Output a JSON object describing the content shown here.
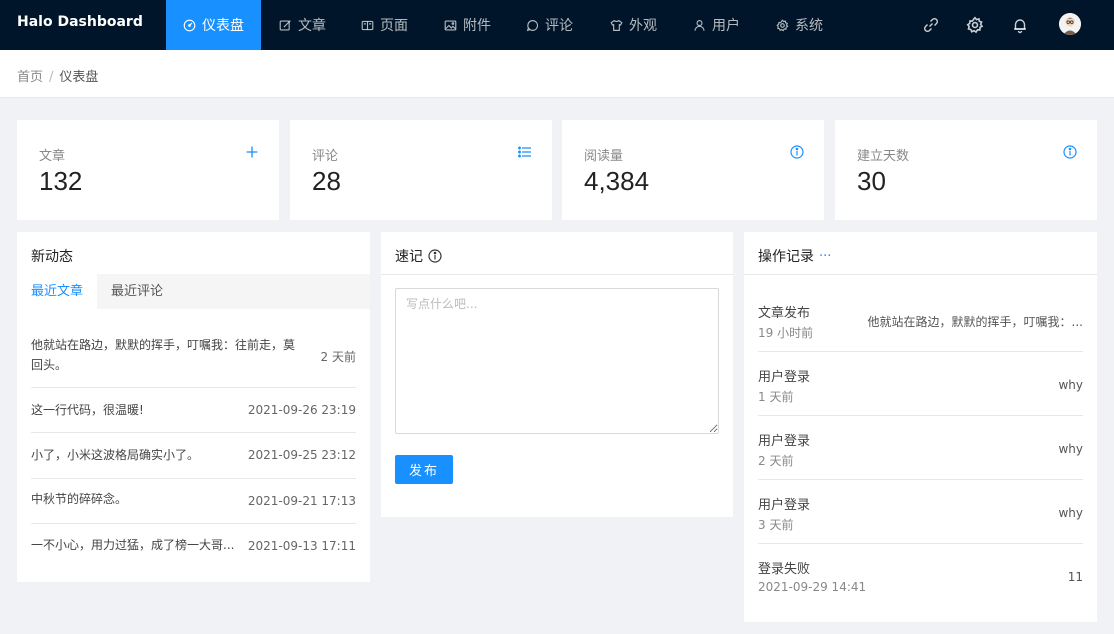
{
  "app": {
    "logo": "Halo Dashboard"
  },
  "nav": {
    "items": [
      {
        "label": "仪表盘",
        "icon": "dashboard-icon",
        "active": true
      },
      {
        "label": "文章",
        "icon": "form-icon"
      },
      {
        "label": "页面",
        "icon": "read-icon"
      },
      {
        "label": "附件",
        "icon": "picture-icon"
      },
      {
        "label": "评论",
        "icon": "message-icon"
      },
      {
        "label": "外观",
        "icon": "skin-icon"
      },
      {
        "label": "用户",
        "icon": "user-icon"
      },
      {
        "label": "系统",
        "icon": "setting-icon"
      }
    ],
    "right_icons": [
      "link-icon",
      "setting-icon",
      "bell-icon",
      "avatar"
    ]
  },
  "breadcrumb": {
    "home": "首页",
    "separator": "/",
    "current": "仪表盘"
  },
  "stats": [
    {
      "label": "文章",
      "value": "132",
      "icon": "plus-icon"
    },
    {
      "label": "评论",
      "value": "28",
      "icon": "list-icon"
    },
    {
      "label": "阅读量",
      "value": "4,384",
      "icon": "info-circle-icon"
    },
    {
      "label": "建立天数",
      "value": "30",
      "icon": "info-circle-icon"
    }
  ],
  "activity": {
    "title": "新动态",
    "tabs": [
      {
        "label": "最近文章",
        "active": true
      },
      {
        "label": "最近评论"
      }
    ],
    "items": [
      {
        "title_line1": "他就站在路边，默默的挥手，叮嘱我：往前走，莫",
        "title_line2": "回头。",
        "date": "2 天前"
      },
      {
        "title": "这一行代码，很温暖!",
        "date": "2021-09-26 23:19"
      },
      {
        "title": "小了，小米这波格局确实小了。",
        "date": "2021-09-25 23:12"
      },
      {
        "title": "中秋节的碎碎念。",
        "date": "2021-09-21 17:13"
      },
      {
        "title": "一不小心，用力过猛，成了榜一大哥...",
        "date": "2021-09-13 17:11"
      }
    ]
  },
  "note": {
    "title": "速记",
    "placeholder": "写点什么吧...",
    "submit_label": "发布"
  },
  "logs": {
    "title": "操作记录",
    "more": "···",
    "items": [
      {
        "action": "文章发布",
        "time": "19 小时前",
        "content": "他就站在路边，默默的挥手，叮嘱我：..."
      },
      {
        "action": "用户登录",
        "time": "1 天前",
        "content": "why"
      },
      {
        "action": "用户登录",
        "time": "2 天前",
        "content": "why"
      },
      {
        "action": "用户登录",
        "time": "3 天前",
        "content": "why"
      },
      {
        "action": "登录失败",
        "time": "2021-09-29 14:41",
        "content": "11"
      }
    ]
  },
  "colors": {
    "topbar": "#001529",
    "accent": "#1890ff",
    "background": "#f0f2f5"
  }
}
